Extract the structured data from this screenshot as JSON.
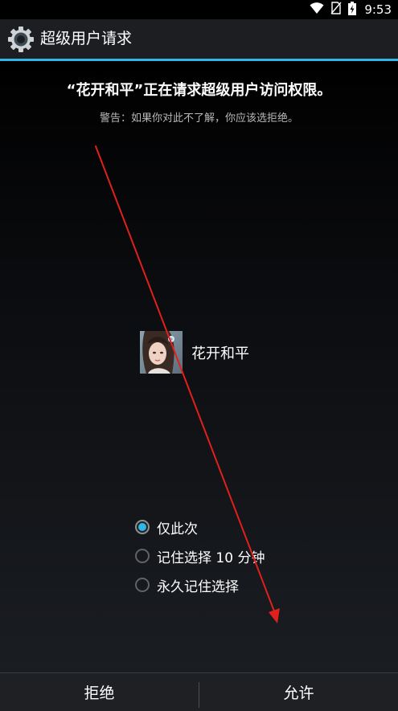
{
  "status_bar": {
    "time": "9:53",
    "icons": [
      "wifi-icon",
      "no-sim-icon",
      "battery-charging-icon"
    ]
  },
  "action_bar": {
    "icon": "settings-gear-icon",
    "title": "超级用户请求"
  },
  "request": {
    "title": "“花开和平”正在请求超级用户访问权限。",
    "warning": "警告：如果你对此不了解，你应该选拒绝。"
  },
  "app": {
    "name": "花开和平",
    "icon": "app-avatar-icon"
  },
  "options": [
    {
      "label": "仅此次",
      "checked": true
    },
    {
      "label": "记住选择 10 分钟",
      "checked": false
    },
    {
      "label": "永久记住选择",
      "checked": false
    }
  ],
  "buttons": {
    "deny": "拒绝",
    "allow": "允许"
  },
  "colors": {
    "accent": "#33b5e5",
    "annotation_arrow": "#e0201c"
  }
}
